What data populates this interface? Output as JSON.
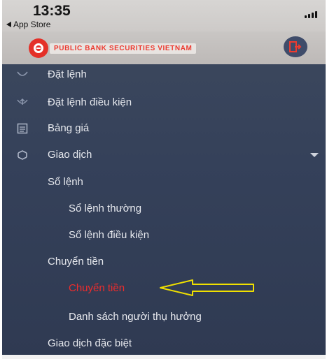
{
  "status_bar": {
    "time": "13:35",
    "back_label": "App Store"
  },
  "header": {
    "brand": "PUBLIC BANK SECURITIES VIETNAM",
    "logout_icon": "logout-icon"
  },
  "menu": [
    {
      "label": "Đặt lệnh",
      "icon": "order-icon",
      "level": 0
    },
    {
      "label": "Đặt lệnh điều kiện",
      "icon": "conditional-order-icon",
      "level": 0
    },
    {
      "label": "Bảng giá",
      "icon": "price-board-icon",
      "level": 0
    },
    {
      "label": "Giao dịch",
      "icon": "transaction-icon",
      "level": 0,
      "expanded": true
    },
    {
      "label": "Sổ lệnh",
      "level": 1
    },
    {
      "label": "Sổ lệnh thường",
      "level": 2
    },
    {
      "label": "Sổ lệnh điều kiện",
      "level": 2
    },
    {
      "label": "Chuyển tiền",
      "level": 1
    },
    {
      "label": "Chuyển tiền",
      "level": 2,
      "active": true
    },
    {
      "label": "Danh sách người thụ hưởng",
      "level": 2
    },
    {
      "label": "Giao dịch đặc biệt",
      "level": 1
    }
  ],
  "colors": {
    "menu_bg": "#35415a",
    "active_text": "#ee2c2c",
    "brand_red": "#e43028",
    "annotation_arrow": "#f0e000"
  }
}
